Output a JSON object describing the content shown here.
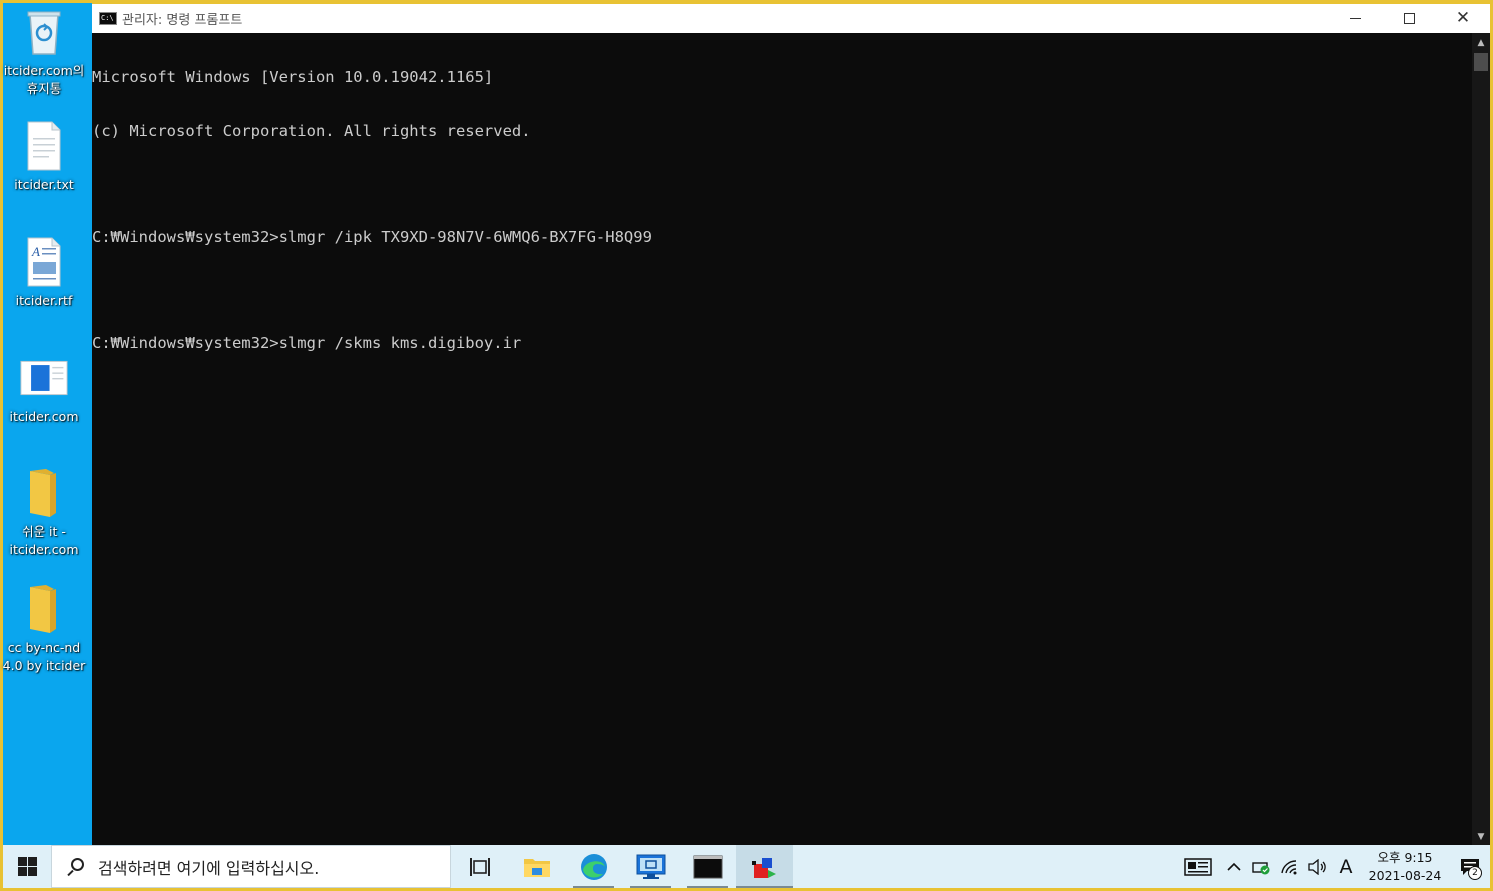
{
  "desktop": {
    "icons": [
      {
        "label": "itcider.com의\n휴지통",
        "icon": "recycle-bin-icon"
      },
      {
        "label": "itcider.txt",
        "icon": "text-file-icon"
      },
      {
        "label": "itcider.rtf",
        "icon": "rtf-file-icon"
      },
      {
        "label": "itcider.com",
        "icon": "web-shortcut-icon"
      },
      {
        "label": "쉬운 it -\nitcider.com",
        "icon": "folder-icon"
      },
      {
        "label": "cc by-nc-nd\n4.0 by itcider",
        "icon": "folder-icon"
      }
    ]
  },
  "window": {
    "title": "관리자: 명령 프롬프트",
    "controls": {
      "minimize": "minimize",
      "maximize": "maximize",
      "close": "close"
    }
  },
  "console": {
    "lines": [
      "Microsoft Windows [Version 10.0.19042.1165]",
      "(c) Microsoft Corporation. All rights reserved.",
      "",
      "C:₩Windows₩system32>slmgr /ipk TX9XD-98N7V-6WMQ6-BX7FG-H8Q99",
      "",
      "C:₩Windows₩system32>slmgr /skms kms.digiboy.ir"
    ]
  },
  "taskbar": {
    "search_placeholder": "검색하려면 여기에 입력하십시오.",
    "apps": [
      {
        "name": "task-view",
        "icon": "task-view-icon"
      },
      {
        "name": "file-explorer",
        "icon": "folder-icon"
      },
      {
        "name": "edge",
        "icon": "edge-icon"
      },
      {
        "name": "remote-desktop",
        "icon": "remote-desktop-icon"
      },
      {
        "name": "command-prompt",
        "icon": "terminal-icon"
      },
      {
        "name": "app-cube",
        "icon": "cube-app-icon"
      }
    ],
    "clock": {
      "time": "오후 9:15",
      "date": "2021-08-24"
    },
    "input_indicator": "A",
    "notification_count": "2"
  },
  "colors": {
    "desktop_bg": "#0aa6ee",
    "console_bg": "#0c0c0c",
    "console_fg": "#cccccc",
    "taskbar_bg": "#dff0f8",
    "accent_frame": "#e8c233"
  }
}
